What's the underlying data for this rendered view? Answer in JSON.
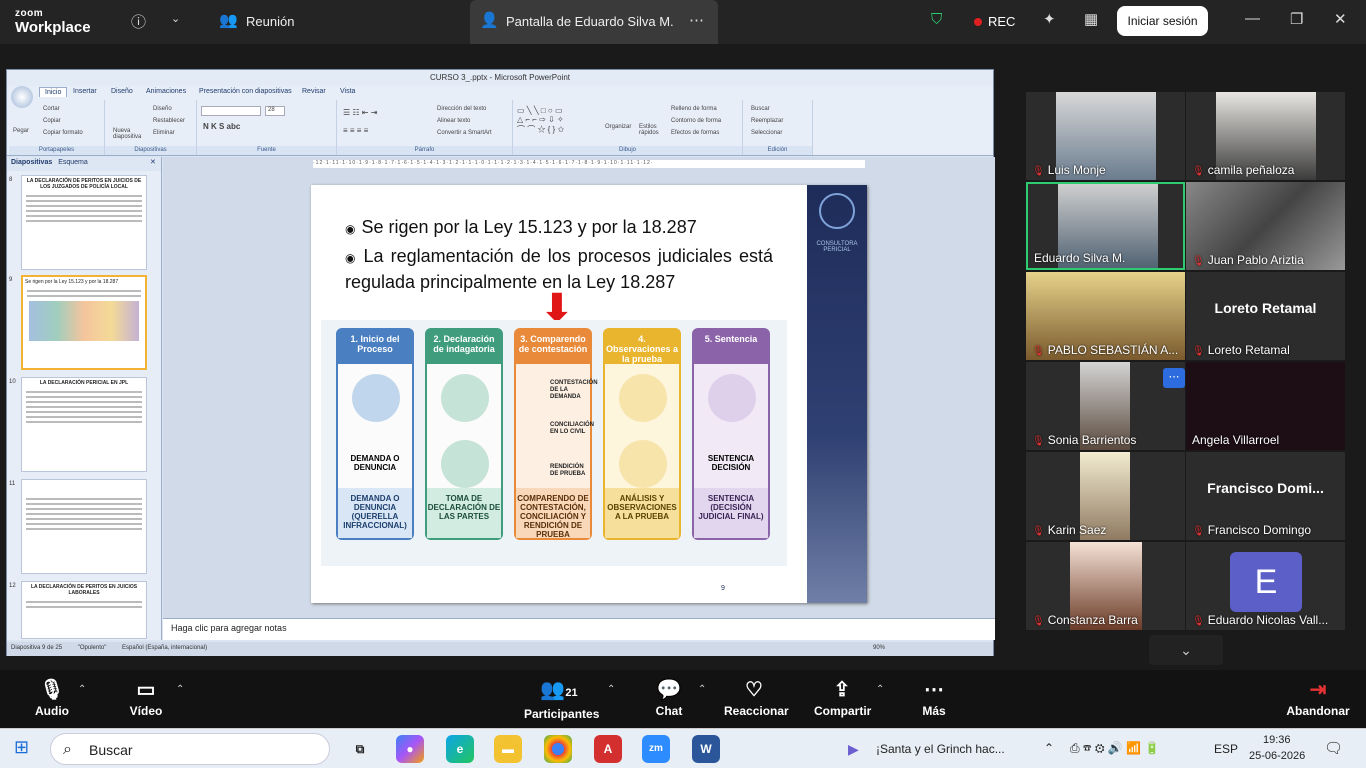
{
  "zoom": {
    "brand_top": "zoom",
    "brand_bottom": "Workplace",
    "meeting_label": "Reunión",
    "share_title": "Pantalla de Eduardo Silva M.",
    "rec_label": "REC",
    "signin_label": "Iniciar sesión"
  },
  "ppt": {
    "title": "CURSO 3_.pptx - Microsoft PowerPoint",
    "tabs": [
      "Inicio",
      "Insertar",
      "Diseño",
      "Animaciones",
      "Presentación con diapositivas",
      "Revisar",
      "Vista"
    ],
    "groups": [
      "Portapapeles",
      "Diapositivas",
      "Fuente",
      "Párrafo",
      "Dibujo",
      "Edición"
    ],
    "ribbon": {
      "paste": "Pegar",
      "cut": "Cortar",
      "copy": "Copiar",
      "format_copy": "Copiar formato",
      "new_slide": "Nueva diapositiva",
      "design": "Diseño",
      "reset": "Restablecer",
      "delete": "Eliminar",
      "font_size": "28",
      "text_dir": "Dirección del texto",
      "align_text": "Alinear texto",
      "smartart": "Convertir a SmartArt",
      "organize": "Organizar",
      "quick_styles": "Estilos rápidos",
      "fill": "Relleno de forma",
      "outline": "Contorno de forma",
      "effects": "Efectos de formas",
      "find": "Buscar",
      "replace": "Reemplazar",
      "select": "Seleccionar"
    },
    "pane_tabs": [
      "Diapositivas",
      "Esquema"
    ],
    "thumbs": [
      {
        "num": "8",
        "title": "LA DECLARACIÓN DE PERITOS EN JUICIOS DE LOS JUZGADOS DE POLICÍA LOCAL"
      },
      {
        "num": "9",
        "title": "Se rigen por la Ley 15.123 y por la 18.287"
      },
      {
        "num": "10",
        "title": "LA DECLARACIÓN PERICIAL EN JPL"
      },
      {
        "num": "11",
        "title": ""
      },
      {
        "num": "12",
        "title": "LA DECLARACIÓN DE PERITOS EN JUICIOS LABORALES"
      }
    ],
    "ruler": "·12·1·11·1·10·1·9·1·8·1·7·1·6·1·5·1·4·1·3·1·2·1·1·1·0·1·1·1·2·1·3·1·4·1·5·1·6·1·7·1·8·1·9·1·10·1·11·1·12·",
    "slide": {
      "bullet1": "Se rigen por la Ley 15.123 y por la 18.287",
      "bullet2": "La reglamentación de los procesos judiciales está regulada principalmente en la Ley 18.287",
      "logo_text": "CONSULTORA PERICIAL",
      "page_number": "9",
      "columns": [
        {
          "head": "1. Inicio del Proceso",
          "mid": "DEMANDA O DENUNCIA",
          "foot": "DEMANDA O DENUNCIA (QUERELLA INFRACCIONAL)",
          "color": "#4a7fc1"
        },
        {
          "head": "2. Declaración de indagatoria",
          "mid": "",
          "foot": "TOMA DE DECLARACIÓN DE LAS PARTES",
          "color": "#3f9c7c"
        },
        {
          "head": "3. Comparendo de contestación",
          "mid": "",
          "foot": "COMPARENDO DE CONTESTACIÓN, CONCILIACIÓN Y RENDICIÓN DE PRUEBA",
          "color": "#e98a3a"
        },
        {
          "head": "4. Observaciones a la prueba",
          "mid": "",
          "foot": "ANÁLISIS Y OBSERVACIONES A LA PRUEBA",
          "color": "#e9b52f"
        },
        {
          "head": "5. Sentencia",
          "mid": "SENTENCIA DECISIÓN",
          "foot": "SENTENCIA (DECISIÓN JUDICIAL FINAL)",
          "color": "#8b63a8"
        }
      ],
      "sub3": [
        "CONTESTACIÓN DE LA DEMANDA",
        "CONCILIACIÓN EN LO CIVIL",
        "RENDICIÓN DE PRUEBA"
      ]
    },
    "notes_placeholder": "Haga clic para agregar notas",
    "status_slide": "Diapositiva 9 de 25",
    "status_theme": "\"Opulento\"",
    "status_lang": "Español (España, internacional)",
    "zoom_level": "90%"
  },
  "participants": [
    {
      "name": "Luis Monje",
      "video": true,
      "muted": true
    },
    {
      "name": "camila peñaloza",
      "video": true,
      "muted": true
    },
    {
      "name": "Eduardo Silva M.",
      "video": true,
      "muted": false,
      "active": true
    },
    {
      "name": "Juan Pablo Ariztia",
      "video": true,
      "muted": true
    },
    {
      "name": "PABLO SEBASTIÁN A...",
      "video": true,
      "muted": true
    },
    {
      "name": "Loreto Retamal",
      "video": false,
      "big": "Loreto Retamal",
      "muted": true
    },
    {
      "name": "Sonia Barrientos",
      "video": true,
      "muted": true
    },
    {
      "name": "Angela Villarroel",
      "video": false,
      "muted": false
    },
    {
      "name": "Karin Saez",
      "video": true,
      "muted": true
    },
    {
      "name": "Francisco Domingo",
      "video": false,
      "big": "Francisco  Domi...",
      "muted": true
    },
    {
      "name": "Constanza Barra",
      "video": true,
      "muted": true
    },
    {
      "name": "Eduardo Nicolas Vall...",
      "video": false,
      "avatar": "E",
      "muted": true
    }
  ],
  "controls": {
    "audio": "Audio",
    "video": "Vídeo",
    "participants": "Participantes",
    "participants_count": "21",
    "chat": "Chat",
    "react": "Reaccionar",
    "share": "Compartir",
    "more": "Más",
    "leave": "Abandonar"
  },
  "taskbar": {
    "search": "Buscar",
    "notification": "¡Santa y el Grinch hac...",
    "lang": "ESP",
    "time": "19:36",
    "date": "25-06-2026"
  },
  "colors": {
    "zoom_bg": "#242424",
    "ppt_ribbon": "#e8eef8",
    "active_border": "#2ecc71",
    "muted": "#e53333"
  }
}
